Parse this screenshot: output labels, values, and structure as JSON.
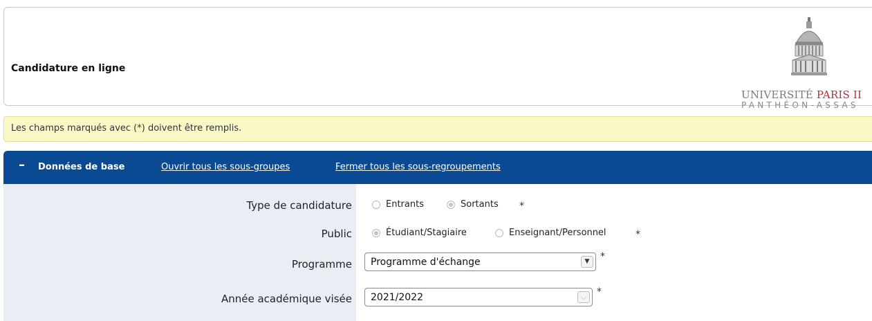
{
  "header": {
    "title": "Candidature en ligne",
    "logo": {
      "line1_a": "UNIVERSITÉ ",
      "line1_b": "PARIS II",
      "line2": "PANTHÉON-ASSAS",
      "icon": "pantheon-dome-icon",
      "accent": "#b0303c"
    }
  },
  "notice": "Les champs marqués avec (*) doivent être remplis.",
  "section": {
    "collapse_symbol": "–",
    "title": "Données de base",
    "open_all_link": "Ouvrir tous les sous-groupes",
    "close_all_link": "Fermer tous les sous-regroupements",
    "color": "#0a4a92"
  },
  "form": {
    "type_candidature": {
      "label": "Type de candidature",
      "options": [
        "Entrants",
        "Sortants"
      ],
      "selected": "Sortants",
      "required_mark": "*"
    },
    "public": {
      "label": "Public",
      "options": [
        "Étudiant/Stagiaire",
        "Enseignant/Personnel"
      ],
      "selected": "Étudiant/Stagiaire",
      "required_mark": "*"
    },
    "programme": {
      "label": "Programme",
      "value": "Programme d'échange",
      "required_mark": "*"
    },
    "annee": {
      "label": "Année académique visée",
      "value": "2021/2022",
      "required_mark": "*"
    }
  }
}
